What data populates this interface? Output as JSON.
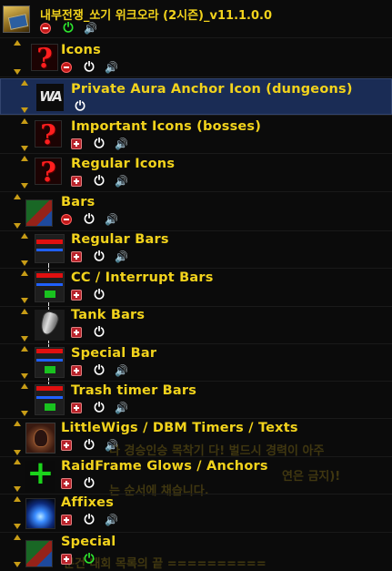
{
  "background_text": [
    "다 경승인승 목착기 다! 벌드시 경력이 아주",
    "연은 금지)!",
    "는 순서에 채습니다.",
    "분건 대회 목록의 끝 =========="
  ],
  "rows": [
    {
      "label": "내부전쟁_쏘기 위크오라 (2시즌)_v11.1.0.0",
      "icon": "addon-icon",
      "buttons": [
        "minus",
        "power-green",
        "speaker"
      ]
    },
    {
      "label": "Icons",
      "icon": "question-mark-icon",
      "buttons": [
        "minus",
        "power",
        "speaker"
      ]
    },
    {
      "label": "Private Aura Anchor Icon (dungeons)",
      "icon": "weakauras-logo-icon",
      "buttons": [
        "power"
      ],
      "selected": true
    },
    {
      "label": "Important Icons (bosses)",
      "icon": "question-mark-icon",
      "buttons": [
        "plus",
        "power",
        "speaker"
      ]
    },
    {
      "label": "Regular Icons",
      "icon": "question-mark-icon",
      "buttons": [
        "plus",
        "power",
        "speaker"
      ]
    },
    {
      "label": "Bars",
      "icon": "group-icon",
      "buttons": [
        "minus",
        "power",
        "speaker"
      ]
    },
    {
      "label": "Regular Bars",
      "icon": "bars-icon",
      "buttons": [
        "plus",
        "power",
        "speaker"
      ]
    },
    {
      "label": "CC / Interrupt Bars",
      "icon": "bars-icon",
      "buttons": [
        "plus",
        "power"
      ]
    },
    {
      "label": "Tank Bars",
      "icon": "shield-icon",
      "buttons": [
        "plus",
        "power"
      ]
    },
    {
      "label": "Special Bar",
      "icon": "bars-icon",
      "buttons": [
        "plus",
        "power",
        "speaker"
      ]
    },
    {
      "label": "Trash timer Bars",
      "icon": "bars-icon",
      "buttons": [
        "plus",
        "power",
        "speaker"
      ]
    },
    {
      "label": "LittleWigs / DBM Timers / Texts",
      "icon": "beast-icon",
      "buttons": [
        "plus",
        "power",
        "speaker"
      ]
    },
    {
      "label": "RaidFrame Glows / Anchors",
      "icon": "green-plus-icon",
      "buttons": [
        "plus",
        "power"
      ]
    },
    {
      "label": "Affixes",
      "icon": "affix-icon",
      "buttons": [
        "plus",
        "power",
        "speaker"
      ]
    },
    {
      "label": "Special",
      "icon": "group-icon",
      "buttons": [
        "plus",
        "power-green"
      ]
    }
  ],
  "colors": {
    "label": "#f2d31c",
    "selected_bg": "#1a2c55",
    "arrow": "#c79c16"
  }
}
